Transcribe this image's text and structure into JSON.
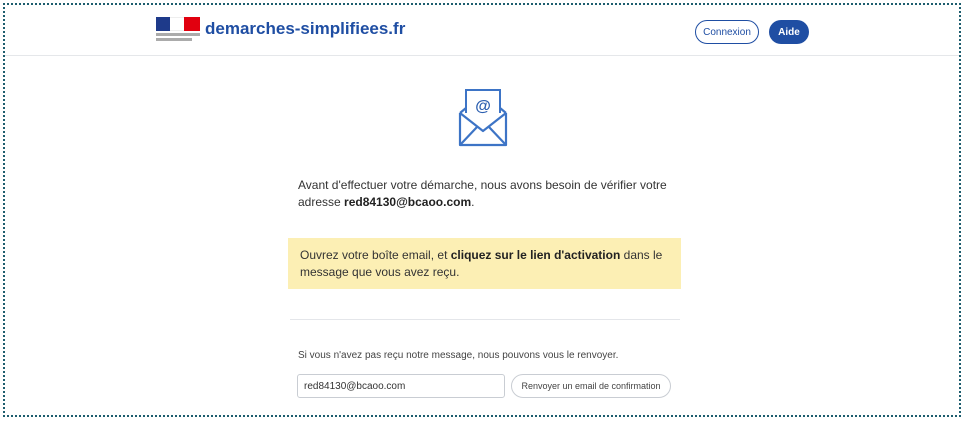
{
  "header": {
    "site_title": "demarches-simplifiees.fr",
    "connexion_label": "Connexion",
    "aide_label": "Aide"
  },
  "content": {
    "icon": "mail-at-icon",
    "intro_text": "Avant d'effectuer votre démarche, nous avons besoin de vérifier votre adresse ",
    "email": "red84130@bcaoo.com",
    "intro_end": ".",
    "notice_before": "Ouvrez votre boîte email, et ",
    "notice_bold": "cliquez sur le lien d'activation",
    "notice_after": " dans le message que vous avez reçu.",
    "resend_prompt": "Si vous n'avez pas reçu notre message, nous pouvons vous le renvoyer.",
    "email_field_value": "red84130@bcaoo.com",
    "resend_button_label": "Renvoyer un email de confirmation"
  },
  "colors": {
    "brand_blue": "#1f4ea3",
    "notice_bg": "#fcefb4"
  }
}
